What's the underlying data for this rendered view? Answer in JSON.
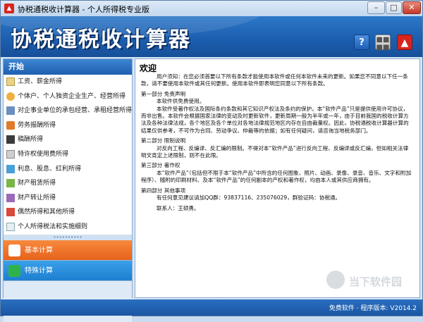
{
  "window": {
    "title": "协税通税收计算器 - 个人所得税专业版",
    "icon_name": "app-logo-icon",
    "controls": {
      "minimize": "–",
      "maximize": "□",
      "close": "✕"
    }
  },
  "header": {
    "app_title": "协税通税收计算器",
    "buttons": [
      {
        "name": "help-icon",
        "glyph": "?"
      },
      {
        "name": "calculator-icon",
        "glyph": "▦"
      },
      {
        "name": "brand-logo-icon",
        "glyph": "▲"
      }
    ],
    "colors": {
      "bar": "#1c5fb0",
      "brand_red": "#d8241c"
    }
  },
  "sidebar": {
    "start_label": "开始",
    "items": [
      {
        "label": "工资、薪金所得",
        "icon": "document-icon"
      },
      {
        "label": "个体户、个人独资企业生产、经营所得",
        "icon": "person-icon"
      },
      {
        "label": "对企事业单位的承包经营、承租经营所得",
        "icon": "building-icon"
      },
      {
        "label": "劳务报酬所得",
        "icon": "briefcase-icon"
      },
      {
        "label": "稿酬所得",
        "icon": "manuscript-icon"
      },
      {
        "label": "特许权使用费所得",
        "icon": "license-icon"
      },
      {
        "label": "利息、股息、红利所得",
        "icon": "interest-icon"
      },
      {
        "label": "财产租赁所得",
        "icon": "lease-icon"
      },
      {
        "label": "财产转让所得",
        "icon": "transfer-icon"
      },
      {
        "label": "偶然所得和其他所得",
        "icon": "chance-icon"
      },
      {
        "label": "个人所得税法和实施细则",
        "icon": "law-icon"
      }
    ],
    "categories": [
      {
        "label": "基本计算",
        "icon": "puzzle-icon",
        "color": "#e6621a"
      },
      {
        "label": "特殊计算",
        "icon": "list-icon",
        "color": "#1e7fd0"
      }
    ]
  },
  "content": {
    "title": "欢迎",
    "intro": "用户须知：在您必须首要以下所有条款才能使用本软件或任何本软件未来的更新。如果您不同意以下任一条款，请不要使用本软件或其任何更新。使用本软件即表明您同意以下所有条款。",
    "sections": [
      {
        "heading": "第一部分  免责声明",
        "lines": [
          "本软件供免费使用。",
          "本软件受著作权法及国际条约条款和其它知识产权法及条约的保护。本“软件产品”只是提供使用许可协议，而非出售。本软件会根据国家法律的变动及时更新软件，更新周期一般为半年或一年，由于目前我国的税收计算方法及各种法律法规，各个地区及各个单位对各地法律规范地区内存在自由裁量权。因此，协税通税收计算器计算的结果仅供参考，不可作为合同、劳动争议、仲裁等的依据；如有任何疑问，请咨询当地税务部门。"
        ]
      },
      {
        "heading": "第二部分  限制说明",
        "lines": [
          "对反向工程、反编译、反汇编的限制。不得对本“软件产品”进行反向工程、反编译或反汇编，但如相关法律明文肯定上述限制，则不在此限。"
        ]
      },
      {
        "heading": "第三部分  著作权",
        "lines": [
          "本“软件产品”（包括但不限于本“软件产品”中所含的任何图象、照片、动画、录像、录音、音乐、文字和附加程序）、随附的印刷材料、及本“软件产品”的任何副本的产权和著作权，均由本人或其供应商拥有。"
        ]
      },
      {
        "heading": "第四部分  其他事项",
        "lines": [
          "有任何意见建议请加QQ群：93837116、235076029，群验证码：协税通。",
          "联系人：王硕勇。"
        ]
      }
    ]
  },
  "watermark": {
    "text": "当下软件园",
    "icon": "watermark-logo-icon"
  },
  "statusbar": {
    "version_text": "免费软件 · 程序版本: V2014.2"
  }
}
